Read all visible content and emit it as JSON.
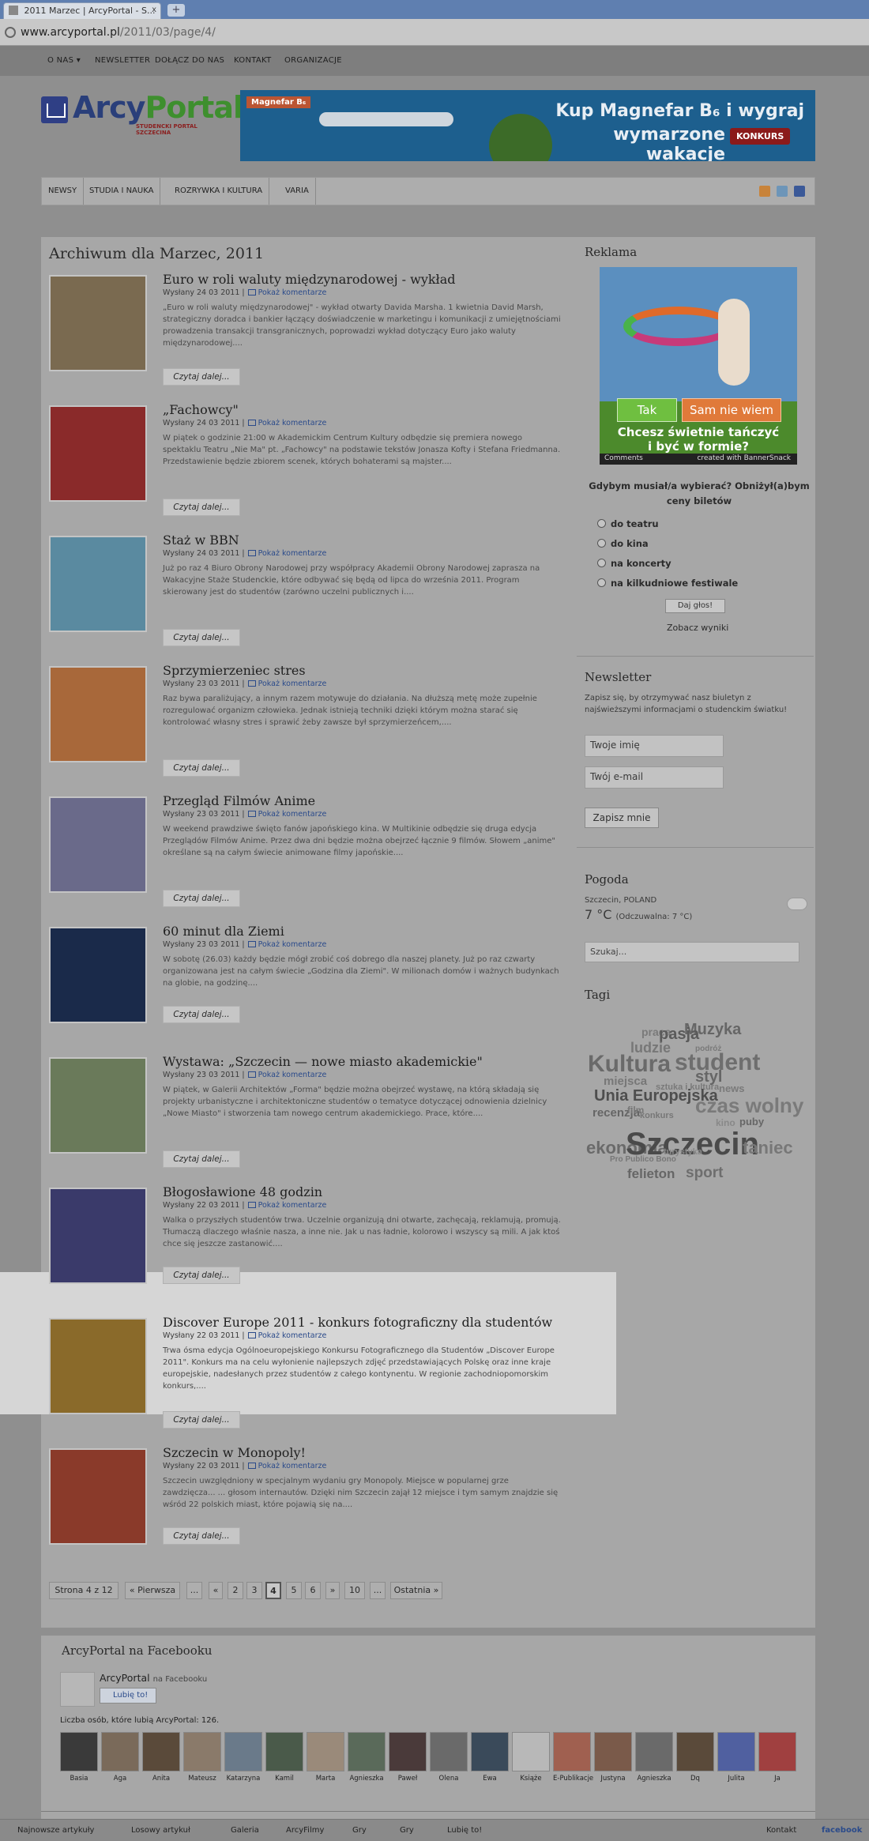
{
  "browser": {
    "tab_title": "2011 Marzec | ArcyPortal - S...",
    "tab_close": "x",
    "new_tab": "+",
    "url_host": "www.arcyportal.pl",
    "url_path": "/2011/03/page/4/"
  },
  "topnav": [
    "O NAS ▾",
    "NEWSLETTER",
    "DOŁĄCZ DO NAS",
    "KONTAKT",
    "ORGANIZACJE"
  ],
  "logo": {
    "arcy": "Arcy",
    "portal": "Portal",
    "tagline": "STUDENCKI PORTAL SZCZECINA"
  },
  "banner": {
    "brand": "Magnefar B₆",
    "line1": "Kup Magnefar B₆ i wygraj",
    "line2": "wymarzone wakacje",
    "badge": "KONKURS"
  },
  "categories": [
    "NEWSY",
    "STUDIA I NAUKA",
    "ROZRYWKA I KULTURA",
    "VARIA"
  ],
  "archive_title": "Archiwum dla Marzec, 2011",
  "comment_link": "Pokaż komentarze",
  "more_label": "Czytaj dalej...",
  "posts": [
    {
      "title": "Euro w roli waluty międzynarodowej - wykład",
      "meta": "Wysłany 24 03 2011 |",
      "excerpt": "„Euro w roli waluty międzynarodowej\" - wykład otwarty Davida Marsha. 1 kwietnia David Marsh, strategiczny doradca i bankier łączący doświadczenie w marketingu i komunikacji z umiejętnościami prowadzenia transakcji transgranicznych, poprowadzi wykład dotyczący Euro jako waluty międzynarodowej...."
    },
    {
      "title": "„Fachowcy\"",
      "meta": "Wysłany 24 03 2011 |",
      "excerpt": "W piątek o godzinie 21:00 w Akademickim Centrum Kultury odbędzie się premiera nowego spektaklu Teatru „Nie Ma\" pt. „Fachowcy\" na podstawie tekstów Jonasza Kofty i Stefana Friedmanna. Przedstawienie będzie zbiorem scenek, których bohaterami są majster...."
    },
    {
      "title": "Staż w BBN",
      "meta": "Wysłany 24 03 2011 |",
      "excerpt": "Już po raz 4 Biuro Obrony Narodowej przy współpracy Akademii Obrony Narodowej zaprasza na Wakacyjne Staże Studenckie, które odbywać się będą od lipca do września 2011. Program skierowany jest do studentów (zarówno uczelni publicznych i...."
    },
    {
      "title": "Sprzymierzeniec stres",
      "meta": "Wysłany 23 03 2011 |",
      "excerpt": "Raz bywa paraliżujący, a innym razem motywuje do działania. Na dłuższą metę może zupełnie rozregulować organizm człowieka. Jednak istnieją techniki dzięki którym można starać się kontrolować własny stres i sprawić żeby zawsze był sprzymierzeńcem,...."
    },
    {
      "title": "Przegląd Filmów Anime",
      "meta": "Wysłany 23 03 2011 |",
      "excerpt": "W weekend prawdziwe święto fanów japońskiego kina. W Multikinie odbędzie się druga edycja Przeglądów Filmów Anime. Przez dwa dni będzie można obejrzeć łącznie 9 filmów. Słowem „anime\" określane są na całym świecie animowane filmy japońskie...."
    },
    {
      "title": "60 minut dla Ziemi",
      "meta": "Wysłany 23 03 2011 |",
      "excerpt": "W sobotę (26.03) każdy będzie mógł zrobić coś dobrego dla naszej planety. Już po raz czwarty organizowana jest na całym świecie „Godzina dla Ziemi\". W milionach domów i ważnych budynkach na globie, na godzinę...."
    },
    {
      "title": "Wystawa: „Szczecin — nowe miasto akademickie\"",
      "meta": "Wysłany 23 03 2011 |",
      "excerpt": "W piątek, w Galerii Architektów „Forma\" będzie można obejrzeć wystawę, na którą składają się projekty urbanistyczne i architektoniczne studentów o tematyce dotyczącej odnowienia dzielnicy „Nowe Miasto\" i stworzenia tam nowego centrum akademickiego. Prace, które...."
    },
    {
      "title": "Błogosławione 48 godzin",
      "meta": "Wysłany 22 03 2011 |",
      "excerpt": "Walka o przyszłych studentów trwa. Uczelnie organizują dni otwarte, zachęcają, reklamują, promują. Tłumaczą dlaczego właśnie nasza, a inne nie. Jak u nas ładnie, kolorowo i wszyscy są mili. A jak ktoś chce się jeszcze zastanowić...."
    },
    {
      "title": "Discover Europe 2011 - konkurs fotograficzny dla studentów",
      "meta": "Wysłany 22 03 2011 |",
      "excerpt": "Trwa ósma edycja Ogólnoeuropejskiego Konkursu Fotograficznego dla Studentów „Discover Europe 2011\". Konkurs ma na celu wyłonienie najlepszych zdjęć przedstawiających Polskę oraz inne kraje europejskie, nadesłanych przez studentów z całego kontynentu. W regionie zachodniopomorskim konkurs,...."
    },
    {
      "title": "Szczecin w Monopoly!",
      "meta": "Wysłany 22 03 2011 |",
      "excerpt": "Szczecin uwzględniony w specjalnym wydaniu gry Monopoly. Miejsce w popularnej grze zawdzięcza... ... głosom internautów. Dzięki nim Szczecin zajął 12 miejsce i tym samym znajdzie się wśród 22 polskich miast, które pojawią się na...."
    }
  ],
  "pagination": [
    "Strona 4 z 12",
    "« Pierwsza",
    "...",
    "«",
    "2",
    "3",
    "4",
    "5",
    "6",
    "»",
    "10",
    "...",
    "Ostatnia »"
  ],
  "sidebar": {
    "ad_heading": "Reklama",
    "ad": {
      "yes": "Tak",
      "no": "Sam nie wiem",
      "question": "Chcesz świetnie tańczyć i być w formie?",
      "comments": "Comments",
      "credit": "created with BannerSnack"
    },
    "poll_question": "Gdybym musiał/a wybierać? Obniżył(a)bym ceny biletów",
    "poll_options": [
      "do teatru",
      "do kina",
      "na koncerty",
      "na kilkudniowe festiwale"
    ],
    "vote": "Daj głos!",
    "results": "Zobacz wyniki",
    "newsletter_heading": "Newsletter",
    "newsletter_text": "Zapisz się, by otrzymywać nasz biuletyn z najświeższymi informacjami o studenckim światku!",
    "name_placeholder": "Twoje imię",
    "email_placeholder": "Twój e-mail",
    "subscribe": "Zapisz mnie",
    "weather_heading": "Pogoda",
    "weather_loc": "Szczecin, POLAND",
    "weather_temp": "7 °C",
    "weather_feel": "(Odczuwalna: 7 °C)",
    "search_placeholder": "Szukaj...",
    "tags_heading": "Tagi",
    "tags": [
      "Muzyka",
      "praca",
      "pasja",
      "ludzie",
      "podróż",
      "Kultura",
      "student",
      "miejsca",
      "styl",
      "sztuka i kultura",
      "news",
      "Unia Europejska",
      "czas wolny",
      "recenzja",
      "film",
      "konkurs",
      "kino",
      "puby",
      "ekonomia",
      "Szczecin",
      "Pro Publico Bono",
      "felieton",
      "sport",
      "turystyka",
      "taniec"
    ]
  },
  "facebook": {
    "heading": "ArcyPortal na Facebooku",
    "page": "ArcyPortal",
    "on_fb": "na Facebooku",
    "like": "Lubię to!",
    "count": "Liczba osób, które lubią ArcyPortal: 126.",
    "faces": [
      "Basia",
      "Aga",
      "Anita",
      "Mateusz",
      "Katarzyna",
      "Kamil",
      "Marta",
      "Agnieszka",
      "Paweł",
      "Olena",
      "Ewa",
      "Książe",
      "E-Publikacje",
      "Justyna",
      "Agnieszka",
      "Dq",
      "Julita",
      "Ja"
    ]
  },
  "statusbar": {
    "items": [
      "Najnowsze artykuły",
      "Losowy artykuł",
      "Galeria",
      "ArcyFilmy",
      "Gry",
      "Gry",
      "Lubię to!",
      "Kontakt",
      "facebook"
    ]
  },
  "colors": {
    "link": "#2a4a8a",
    "logo_green": "#3e8f2e",
    "logo_blue": "#2a3f7a",
    "banner": "#1d5f8e"
  }
}
